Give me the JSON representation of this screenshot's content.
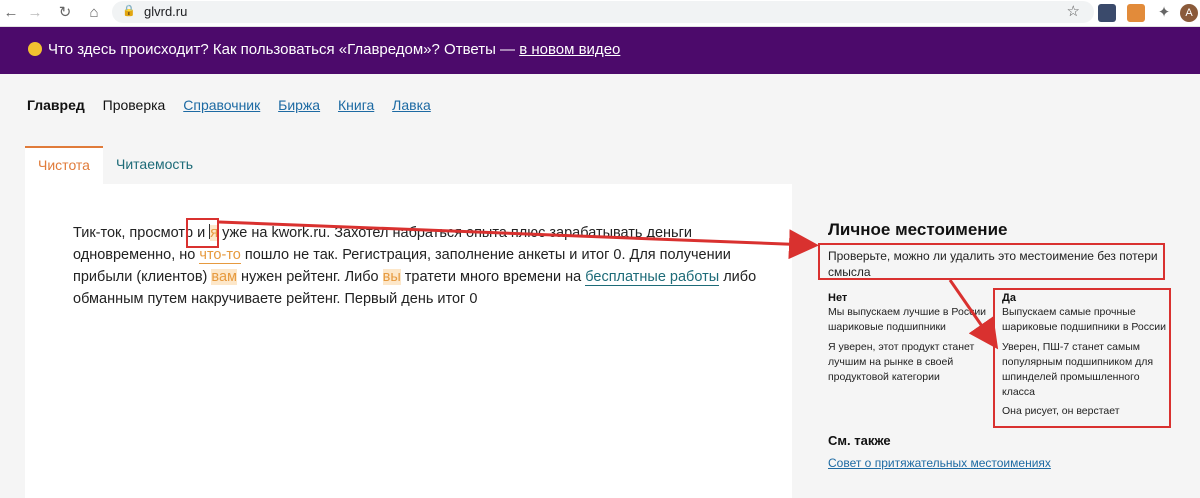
{
  "browser": {
    "url": "glvrd.ru",
    "avatar_letter": "A"
  },
  "banner": {
    "text": "Что здесь происходит? Как пользоваться «Главредом»? Ответы — ",
    "link": "в новом видео"
  },
  "topnav": {
    "items": [
      "Главред",
      "Проверка",
      "Справочник",
      "Биржа",
      "Книга",
      "Лавка"
    ]
  },
  "tabs": [
    "Чистота",
    "Читаемость"
  ],
  "editor": {
    "t1": "Тик-ток, просмотр и ",
    "t2": "я",
    "t3": " уже на kwork.ru. Захотел набраться опыта плюс зарабатывать деньги одновременно, но ",
    "t4": "что-то",
    "t5": " пошло не так. Регистрация, заполнение анкеты и итог 0. Для получении прибыли (клиентов) ",
    "t6": "вам",
    "t7": " нужен рейтенг. Либо ",
    "t8": "вы",
    "t9": " тратети много времени на ",
    "t10": "бесплатные работы",
    "t11": " либо обманным путем накручиваете рейтенг. Первый день итог 0"
  },
  "panel": {
    "title": "Личное местоимение",
    "description": "Проверьте, можно ли удалить это местоимение без потери смысла",
    "no": {
      "heading": "Нет",
      "items": [
        "Мы выпускаем лучшие в России шариковые подшипники",
        "Я уверен, этот продукт станет лучшим на рынке в своей продуктовой категории"
      ]
    },
    "yes": {
      "heading": "Да",
      "items": [
        "Выпускаем самые прочные шариковые подшипники в России",
        "Уверен, ПШ-7 станет самым популярным подшипником для шпинделей промышленного класса",
        "Она рисует, он верстает"
      ]
    },
    "see_also": "См. также",
    "see_also_link": "Совет о притяжательных местоимениях"
  },
  "colors": {
    "banner": "#4c0a6b",
    "accent": "#e07b3a",
    "annotation": "#d9312f",
    "link": "#1d6aa3"
  }
}
